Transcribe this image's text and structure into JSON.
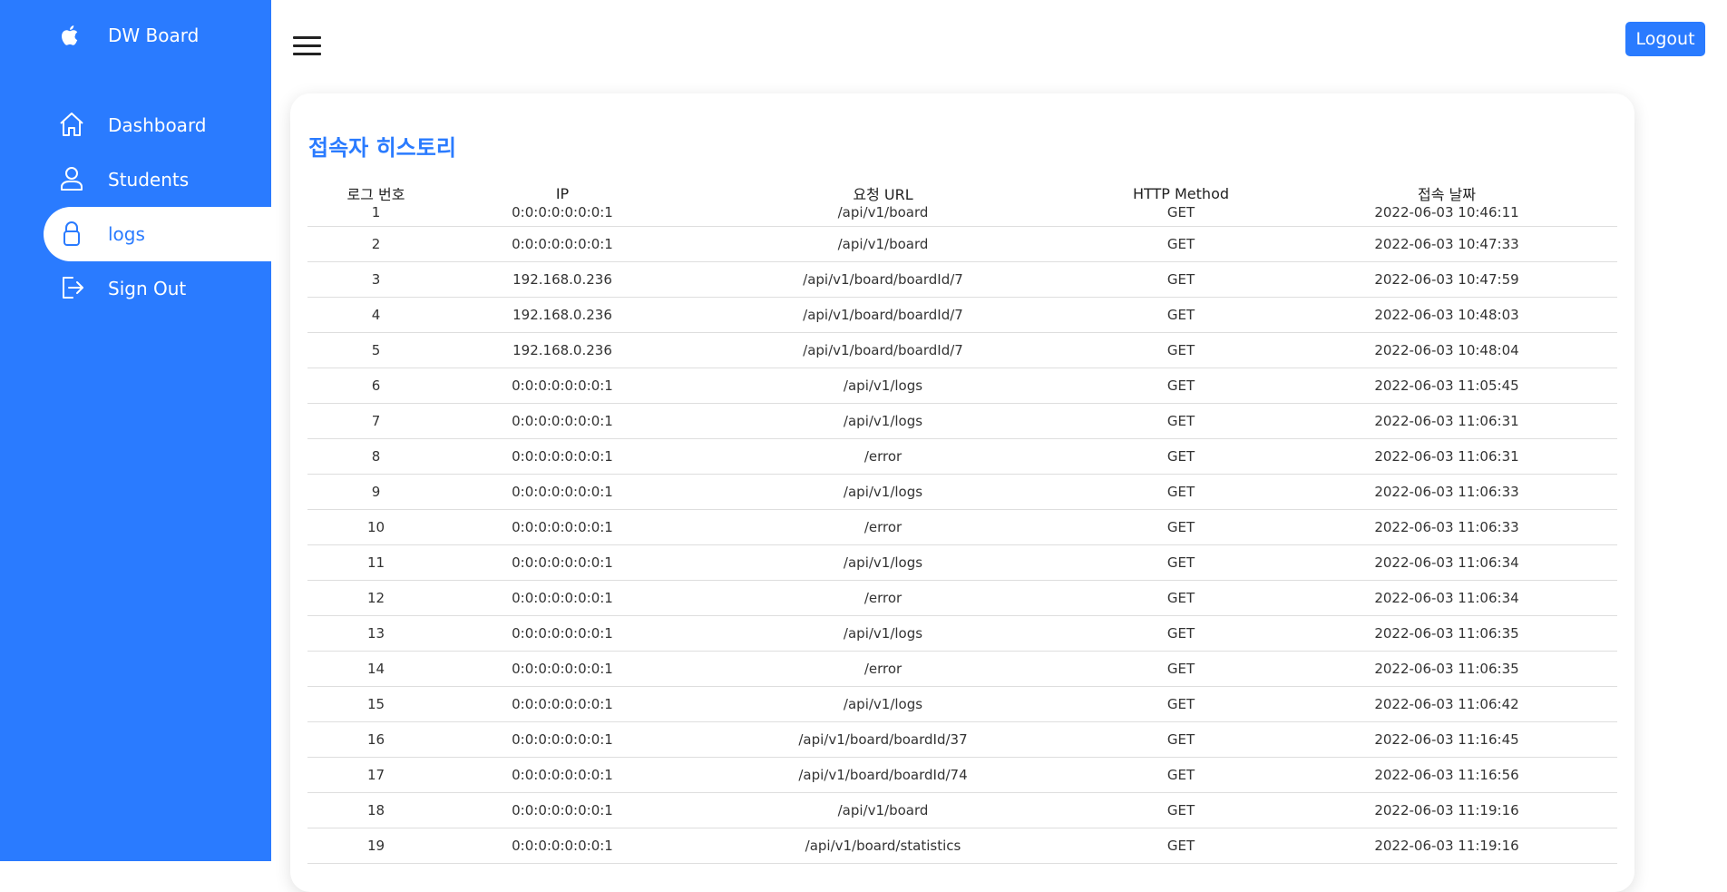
{
  "app": {
    "brand": "DW Board",
    "logo_icon": "apple-logo-icon",
    "accent_color": "#2a7bff"
  },
  "sidebar": {
    "items": [
      {
        "label": "Dashboard",
        "icon": "home-icon"
      },
      {
        "label": "Students",
        "icon": "user-icon"
      },
      {
        "label": "logs",
        "icon": "lock-icon",
        "active": true
      },
      {
        "label": "Sign Out",
        "icon": "sign-out-icon"
      }
    ]
  },
  "header": {
    "menu_icon": "hamburger-menu-icon",
    "logout_label": "Logout"
  },
  "main": {
    "title": "접속자 히스토리",
    "table": {
      "columns": [
        "로그 번호",
        "IP",
        "요청 URL",
        "HTTP Method",
        "접속 날짜"
      ],
      "rows": [
        [
          "1",
          "0:0:0:0:0:0:0:1",
          "/api/v1/board",
          "GET",
          "2022-06-03 10:46:11"
        ],
        [
          "2",
          "0:0:0:0:0:0:0:1",
          "/api/v1/board",
          "GET",
          "2022-06-03 10:47:33"
        ],
        [
          "3",
          "192.168.0.236",
          "/api/v1/board/boardId/7",
          "GET",
          "2022-06-03 10:47:59"
        ],
        [
          "4",
          "192.168.0.236",
          "/api/v1/board/boardId/7",
          "GET",
          "2022-06-03 10:48:03"
        ],
        [
          "5",
          "192.168.0.236",
          "/api/v1/board/boardId/7",
          "GET",
          "2022-06-03 10:48:04"
        ],
        [
          "6",
          "0:0:0:0:0:0:0:1",
          "/api/v1/logs",
          "GET",
          "2022-06-03 11:05:45"
        ],
        [
          "7",
          "0:0:0:0:0:0:0:1",
          "/api/v1/logs",
          "GET",
          "2022-06-03 11:06:31"
        ],
        [
          "8",
          "0:0:0:0:0:0:0:1",
          "/error",
          "GET",
          "2022-06-03 11:06:31"
        ],
        [
          "9",
          "0:0:0:0:0:0:0:1",
          "/api/v1/logs",
          "GET",
          "2022-06-03 11:06:33"
        ],
        [
          "10",
          "0:0:0:0:0:0:0:1",
          "/error",
          "GET",
          "2022-06-03 11:06:33"
        ],
        [
          "11",
          "0:0:0:0:0:0:0:1",
          "/api/v1/logs",
          "GET",
          "2022-06-03 11:06:34"
        ],
        [
          "12",
          "0:0:0:0:0:0:0:1",
          "/error",
          "GET",
          "2022-06-03 11:06:34"
        ],
        [
          "13",
          "0:0:0:0:0:0:0:1",
          "/api/v1/logs",
          "GET",
          "2022-06-03 11:06:35"
        ],
        [
          "14",
          "0:0:0:0:0:0:0:1",
          "/error",
          "GET",
          "2022-06-03 11:06:35"
        ],
        [
          "15",
          "0:0:0:0:0:0:0:1",
          "/api/v1/logs",
          "GET",
          "2022-06-03 11:06:42"
        ],
        [
          "16",
          "0:0:0:0:0:0:0:1",
          "/api/v1/board/boardId/37",
          "GET",
          "2022-06-03 11:16:45"
        ],
        [
          "17",
          "0:0:0:0:0:0:0:1",
          "/api/v1/board/boardId/74",
          "GET",
          "2022-06-03 11:16:56"
        ],
        [
          "18",
          "0:0:0:0:0:0:0:1",
          "/api/v1/board",
          "GET",
          "2022-06-03 11:19:16"
        ],
        [
          "19",
          "0:0:0:0:0:0:0:1",
          "/api/v1/board/statistics",
          "GET",
          "2022-06-03 11:19:16"
        ]
      ]
    }
  }
}
